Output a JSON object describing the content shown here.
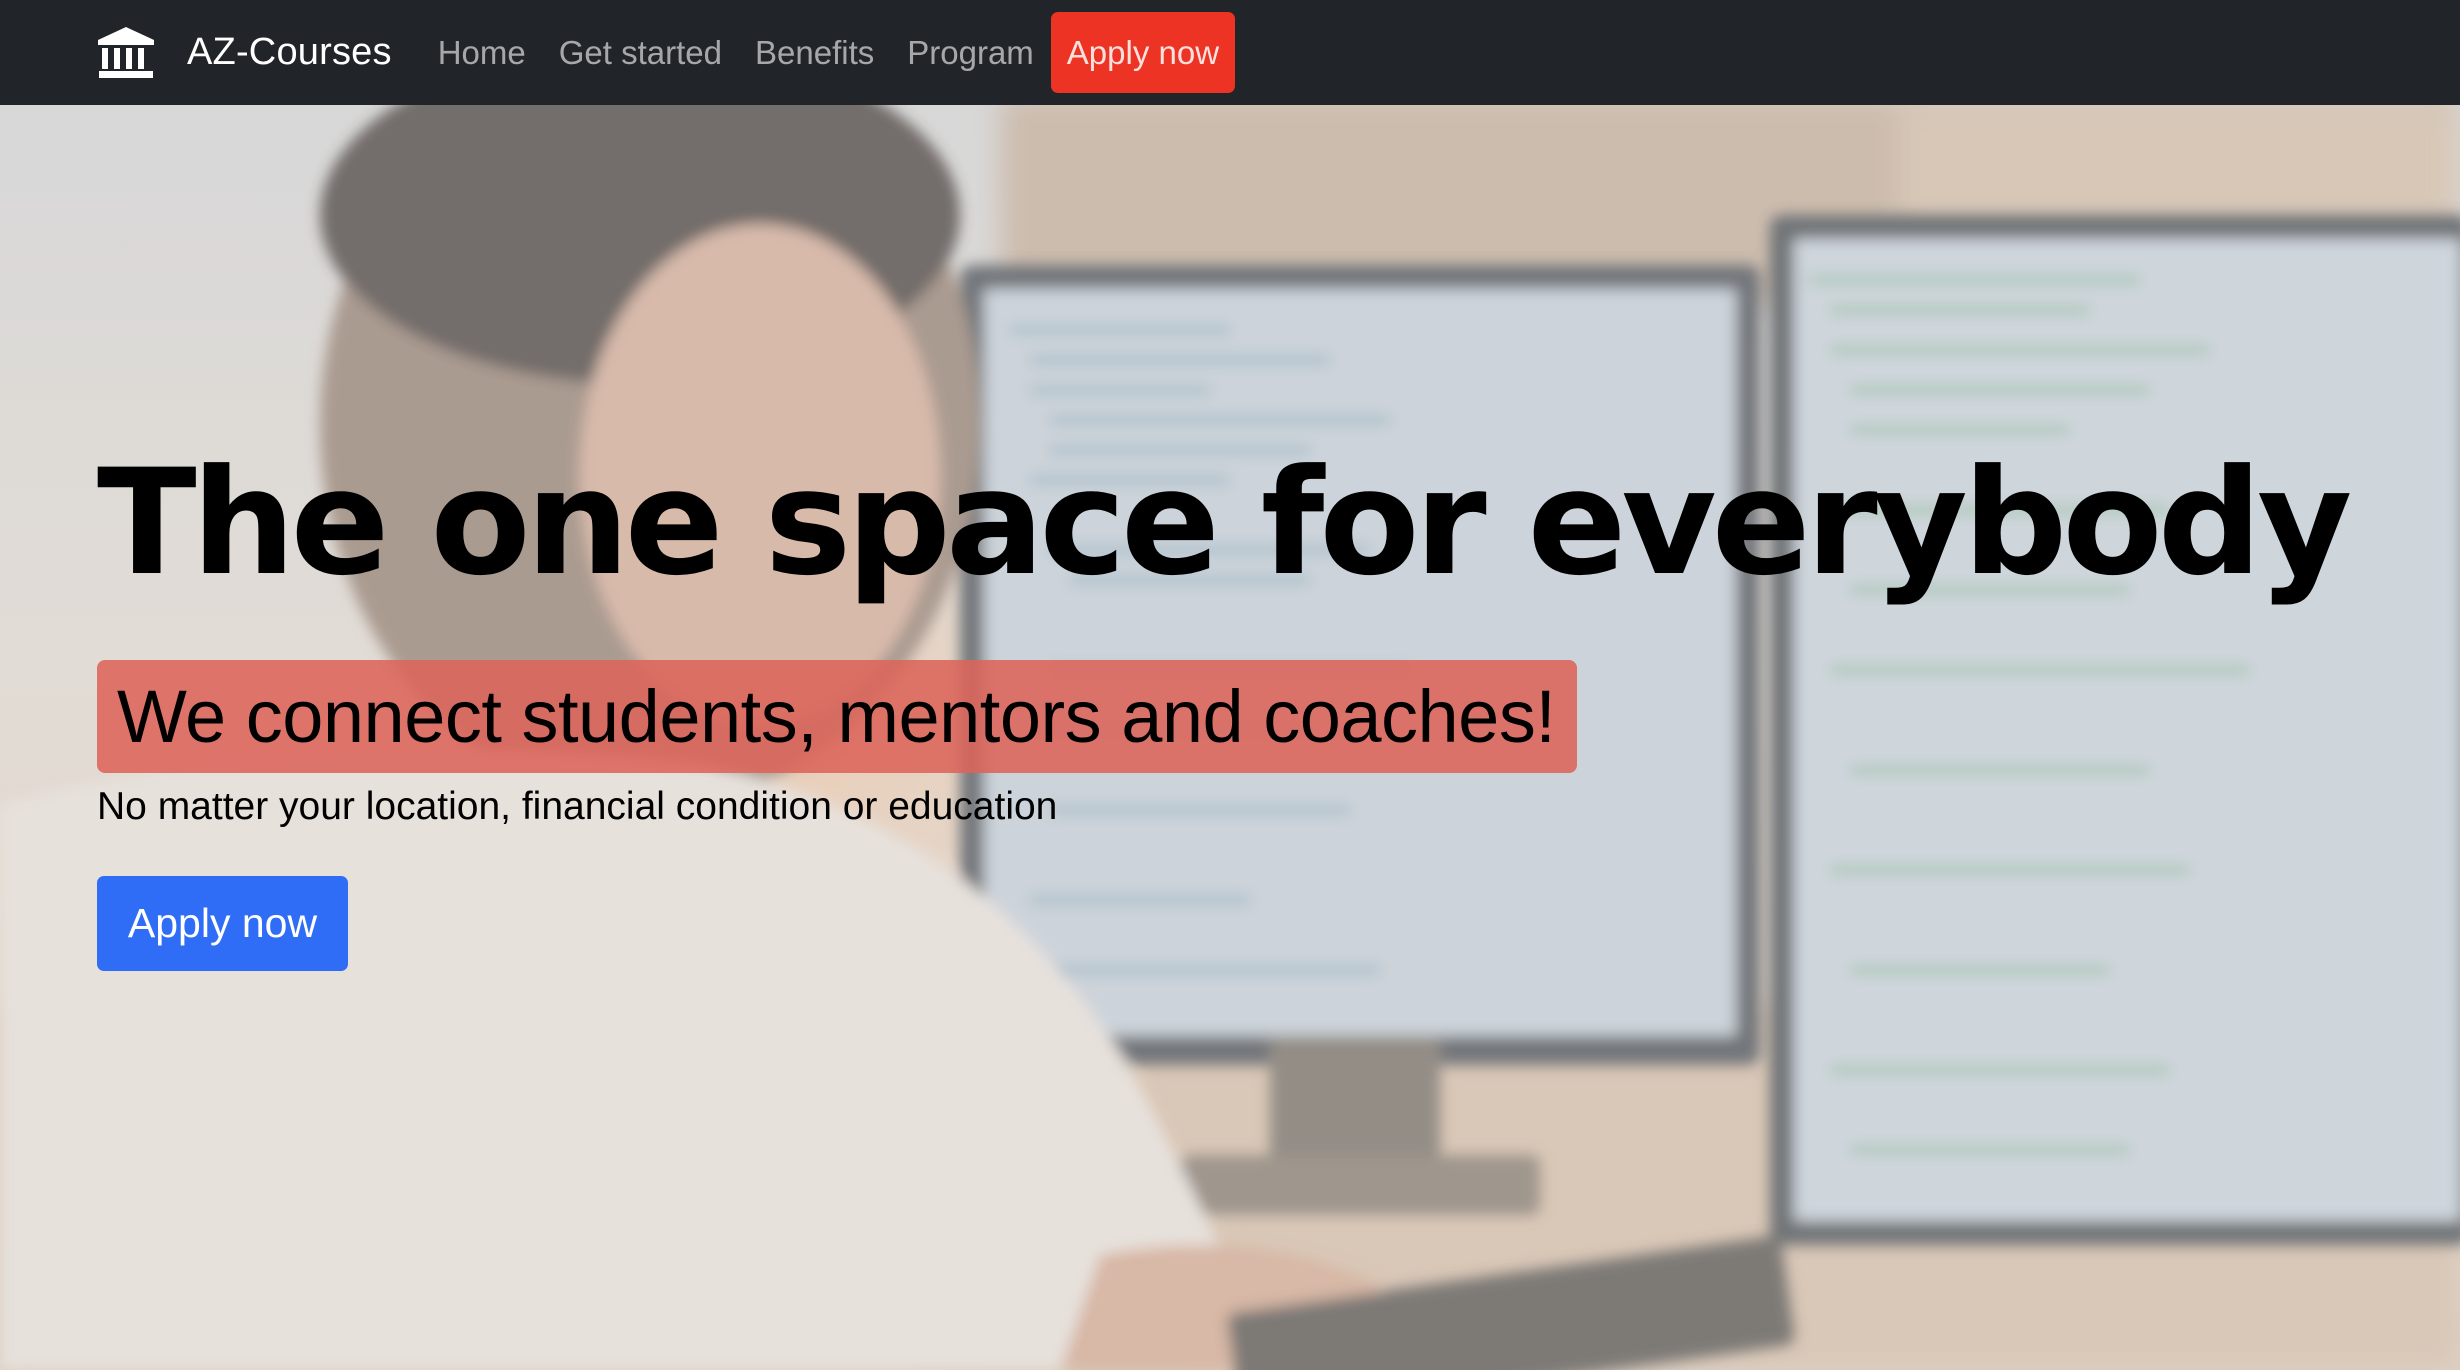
{
  "colors": {
    "navbar_bg": "#212529",
    "nav_apply_bg": "#ec3324",
    "tagline_bg": "#dc645a",
    "cta_bg": "#2f6df6"
  },
  "navbar": {
    "brand_icon": "bank-icon",
    "brand": "AZ-Courses",
    "links": [
      "Home",
      "Get started",
      "Benefits",
      "Program"
    ],
    "apply": "Apply now"
  },
  "hero": {
    "background_image": "developer-at-computer-photo",
    "headline": "The one space for everybody",
    "tagline": "We connect students, mentors and coaches!",
    "subline": "No matter your location, financial condition or education",
    "cta": "Apply now"
  }
}
